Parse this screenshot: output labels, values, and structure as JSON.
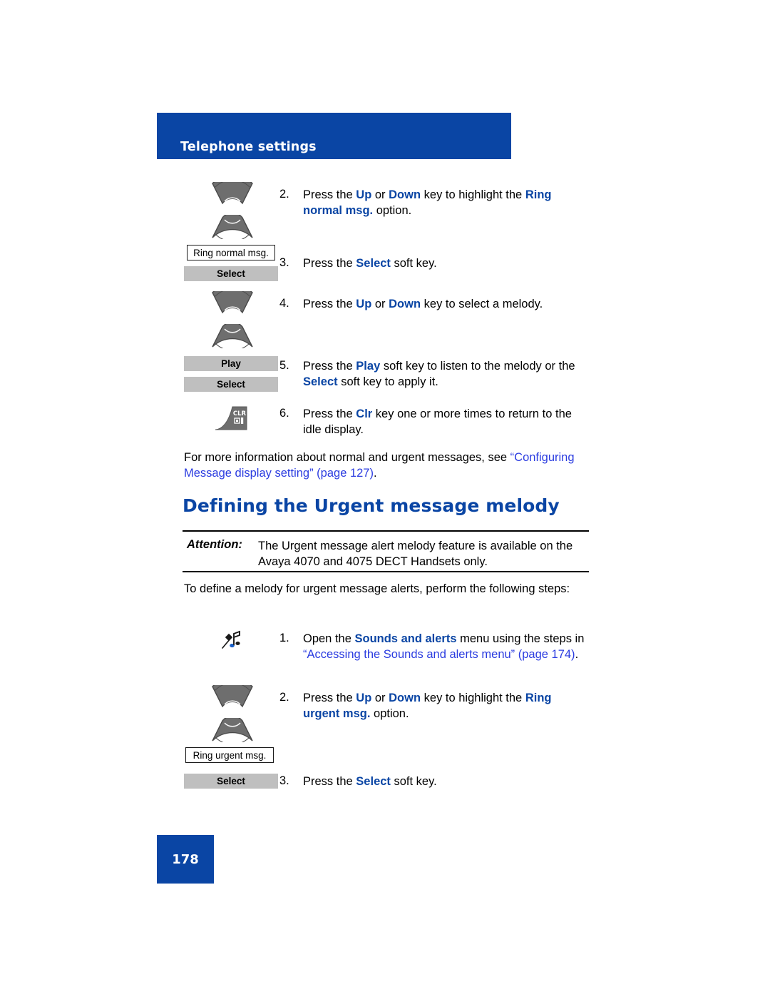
{
  "header": {
    "title": "Telephone settings"
  },
  "steps_first": [
    {
      "num": "2.",
      "icon": "rocker-up-down-key-icon",
      "parts": [
        {
          "t": "Press the ",
          "s": "n"
        },
        {
          "t": "Up",
          "s": "b"
        },
        {
          "t": " or ",
          "s": "n"
        },
        {
          "t": "Down",
          "s": "b"
        },
        {
          "t": " key to highlight the ",
          "s": "n"
        },
        {
          "t": "Ring normal msg.",
          "s": "b"
        },
        {
          "t": " option.",
          "s": "n"
        }
      ]
    },
    {
      "num": "3.",
      "icon": "softkey-select-icon",
      "parts": [
        {
          "t": "Press the ",
          "s": "n"
        },
        {
          "t": "Select",
          "s": "b"
        },
        {
          "t": " soft key.",
          "s": "n"
        }
      ]
    },
    {
      "num": "4.",
      "icon": "rocker-up-down-key-icon",
      "parts": [
        {
          "t": "Press the ",
          "s": "n"
        },
        {
          "t": "Up",
          "s": "b"
        },
        {
          "t": " or ",
          "s": "n"
        },
        {
          "t": "Down",
          "s": "b"
        },
        {
          "t": " key to select a melody.",
          "s": "n"
        }
      ]
    },
    {
      "num": "5.",
      "icon": "softkey-play-select-icon",
      "parts": [
        {
          "t": "Press the ",
          "s": "n"
        },
        {
          "t": "Play",
          "s": "b"
        },
        {
          "t": " soft key to listen to the melody or the ",
          "s": "n"
        },
        {
          "t": "Select",
          "s": "b"
        },
        {
          "t": " soft key to apply it.",
          "s": "n"
        }
      ]
    },
    {
      "num": "6.",
      "icon": "clr-key-icon",
      "parts": [
        {
          "t": "Press the ",
          "s": "n"
        },
        {
          "t": "Clr",
          "s": "b"
        },
        {
          "t": " key one or more times to return to the idle display.",
          "s": "n"
        }
      ]
    }
  ],
  "lcd_labels": {
    "ring_normal": "Ring normal msg.",
    "ring_urgent": "Ring urgent msg."
  },
  "softkey_labels": {
    "select": "Select",
    "play": "Play",
    "select2": "Select",
    "select3": "Select"
  },
  "clr_key": {
    "label": "CLR"
  },
  "cross_ref_paragraph": {
    "lead": "For more information about normal and urgent messages, see ",
    "link": "“Configuring Message display setting” (page 127)",
    "tail": "."
  },
  "heading": {
    "text": "Defining the Urgent message melody"
  },
  "attention": {
    "label": "Attention:",
    "body": "The Urgent message alert melody feature is available on the Avaya 4070 and 4075 DECT Handsets only."
  },
  "intro": {
    "text": "To define a melody for urgent message alerts, perform the following steps:"
  },
  "steps_second": [
    {
      "num": "1.",
      "icon": "sounds-and-alerts-icon",
      "parts": [
        {
          "t": "Open the ",
          "s": "n"
        },
        {
          "t": "Sounds and alerts",
          "s": "b"
        },
        {
          "t": " menu using the steps in ",
          "s": "n"
        },
        {
          "t": "“Accessing the Sounds and alerts menu” (page 174)",
          "s": "l"
        },
        {
          "t": ".",
          "s": "n"
        }
      ]
    },
    {
      "num": "2.",
      "icon": "rocker-up-down-key-icon",
      "parts": [
        {
          "t": "Press the ",
          "s": "n"
        },
        {
          "t": "Up",
          "s": "b"
        },
        {
          "t": " or ",
          "s": "n"
        },
        {
          "t": "Down",
          "s": "b"
        },
        {
          "t": " key to highlight the ",
          "s": "n"
        },
        {
          "t": "Ring urgent msg.",
          "s": "b"
        },
        {
          "t": " option.",
          "s": "n"
        }
      ]
    },
    {
      "num": "3.",
      "icon": "softkey-select-icon",
      "parts": [
        {
          "t": "Press the ",
          "s": "n"
        },
        {
          "t": "Select",
          "s": "b"
        },
        {
          "t": " soft key.",
          "s": "n"
        }
      ]
    }
  ],
  "footer": {
    "page_number": "178"
  },
  "colors": {
    "brand_blue": "#0a45a4",
    "link_blue": "#2b3ce0",
    "softkey_gray": "#bfbfbf",
    "icon_gray": "#6e6e6e"
  }
}
